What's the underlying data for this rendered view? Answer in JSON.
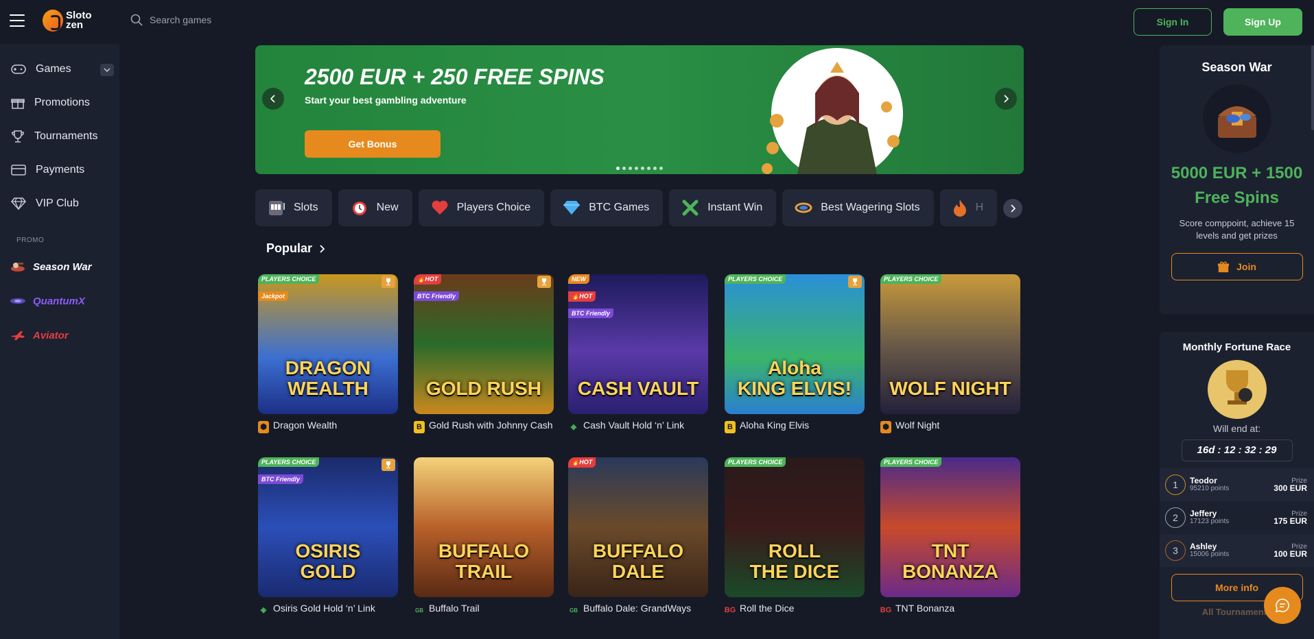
{
  "header": {
    "logo_line1": "Sloto",
    "logo_line2": "zen",
    "search_placeholder": "Search games",
    "signin_label": "Sign In",
    "signup_label": "Sign Up"
  },
  "sidebar": {
    "items": [
      {
        "label": "Games",
        "icon": "gamepad-icon"
      },
      {
        "label": "Promotions",
        "icon": "gift-icon"
      },
      {
        "label": "Tournaments",
        "icon": "trophy-icon"
      },
      {
        "label": "Payments",
        "icon": "card-icon"
      },
      {
        "label": "VIP Club",
        "icon": "diamond-icon"
      }
    ],
    "promo_label": "PROMO",
    "promos": [
      {
        "label": "Season War",
        "color": "#ffffff"
      },
      {
        "label": "QuantumX",
        "color": "#8b5cf6"
      },
      {
        "label": "Aviator",
        "color": "#e53e3e"
      }
    ]
  },
  "banner": {
    "title": "2500 EUR + 250 FREE SPINS",
    "subtitle": "Start your best gambling adventure",
    "button": "Get Bonus",
    "slide_count": 8,
    "active_slide": 0
  },
  "categories": [
    {
      "label": "Slots",
      "icon": "slot-machine-icon"
    },
    {
      "label": "New",
      "icon": "alarm-clock-icon"
    },
    {
      "label": "Players Choice",
      "icon": "heart-icon"
    },
    {
      "label": "BTC Games",
      "icon": "diamond-icon"
    },
    {
      "label": "Instant Win",
      "icon": "crossed-icon"
    },
    {
      "label": "Best Wagering Slots",
      "icon": "cycle-icon"
    },
    {
      "label": "H",
      "icon": "fire-icon"
    }
  ],
  "popular": {
    "title": "Popular",
    "games": [
      {
        "name": "Dragon Wealth",
        "art": "DRAGON\nWEALTH",
        "bg": "linear-gradient(180deg,#c9981e,#3b6fd1 60%,#1c2f86)",
        "badges": [
          "PLAYERS CHOICE",
          "Jackpot"
        ],
        "trophy": true,
        "provider": "shield"
      },
      {
        "name": "Gold Rush with Johnny Cash",
        "art": "GOLD RUSH",
        "bg": "linear-gradient(180deg,#6a3b1a,#2b6b2a 50%,#c9881e)",
        "badges": [
          "HOT",
          "BTC Friendly"
        ],
        "trophy": true,
        "provider": "B"
      },
      {
        "name": "Cash Vault Hold ‘n’ Link",
        "art": "CASH VAULT",
        "bg": "linear-gradient(180deg,#1d1a5a,#5a3aa8 55%,#2a1f70)",
        "badges": [
          "NEW",
          "HOT",
          "BTC Friendly"
        ],
        "trophy": false,
        "provider": "diamond"
      },
      {
        "name": "Aloha King Elvis",
        "art": "Aloha\nKING ELVIS!",
        "bg": "linear-gradient(180deg,#2b8fd8,#3ab46a 60%,#2a7fd0)",
        "badges": [
          "PLAYERS CHOICE"
        ],
        "trophy": true,
        "provider": "B"
      },
      {
        "name": "Wolf Night",
        "art": "WOLF NIGHT",
        "bg": "linear-gradient(180deg,#c89a3a,#6a5a48 50%,#24203a)",
        "badges": [
          "PLAYERS CHOICE"
        ],
        "trophy": false,
        "provider": "shield"
      },
      {
        "name": "Osiris Gold Hold ‘n’ Link",
        "art": "OSIRIS\nGOLD",
        "bg": "linear-gradient(180deg,#1b2a6a,#2b4fb8 50%,#1a2a70)",
        "badges": [
          "PLAYERS CHOICE",
          "BTC Friendly"
        ],
        "trophy": true,
        "provider": "diamond"
      },
      {
        "name": "Buffalo Trail",
        "art": "BUFFALO TRAIL",
        "bg": "linear-gradient(180deg,#f3d27a,#b8602a 50%,#5a2a14)",
        "badges": [],
        "trophy": false,
        "provider": "GB"
      },
      {
        "name": "Buffalo Dale: GrandWays",
        "art": "BUFFALO DALE",
        "bg": "linear-gradient(180deg,#2a3a5a,#6a4a2a 50%,#3a2418)",
        "badges": [
          "HOT"
        ],
        "trophy": false,
        "provider": "GB"
      },
      {
        "name": "Roll the Dice",
        "art": "ROLL\nTHE DICE",
        "bg": "linear-gradient(180deg,#2a1a1a,#3a1a1a 50%,#1a4a2a)",
        "badges": [
          "PLAYERS CHOICE"
        ],
        "trophy": false,
        "provider": "BG"
      },
      {
        "name": "TNT Bonanza",
        "art": "TNT\nBONANZA",
        "bg": "linear-gradient(180deg,#4a2a8a,#c84a2a 50%,#6a2a8a)",
        "badges": [
          "PLAYERS CHOICE"
        ],
        "trophy": false,
        "provider": "BG"
      }
    ]
  },
  "season_war": {
    "title": "Season War",
    "prize": "5000 EUR + 1500 Free Spins",
    "description": "Score comppoint, achieve 15 levels and get prizes",
    "button": "Join"
  },
  "fortune_race": {
    "title": "Monthly Fortune Race",
    "ends_label": "Will end at:",
    "timer": "16d : 12 : 32 : 29",
    "leaderboard": [
      {
        "rank": "1",
        "name": "Teodor",
        "points": "95210 points",
        "prize_label": "Prize",
        "prize": "300 EUR"
      },
      {
        "rank": "2",
        "name": "Jeffery",
        "points": "17123 points",
        "prize_label": "Prize",
        "prize": "175 EUR"
      },
      {
        "rank": "3",
        "name": "Ashley",
        "points": "15006 points",
        "prize_label": "Prize",
        "prize": "100 EUR"
      }
    ],
    "more_button": "More info",
    "all_link": "All Tournaments"
  },
  "colors": {
    "accent_green": "#4eb35a",
    "accent_orange": "#e68a1e",
    "bg": "#161a26",
    "panel": "#1c2130"
  }
}
